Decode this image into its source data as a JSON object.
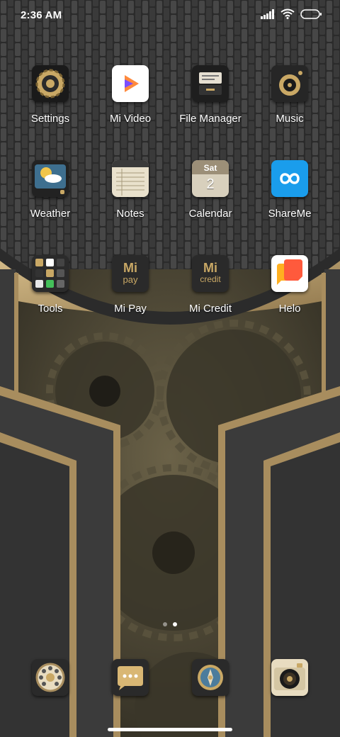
{
  "status_bar": {
    "time": "2:36 AM"
  },
  "apps": [
    {
      "label": "Settings",
      "icon": "settings-gear-icon"
    },
    {
      "label": "Mi Video",
      "icon": "play-icon"
    },
    {
      "label": "File Manager",
      "icon": "file-cabinet-icon"
    },
    {
      "label": "Music",
      "icon": "speaker-icon"
    },
    {
      "label": "Weather",
      "icon": "weather-tv-icon"
    },
    {
      "label": "Notes",
      "icon": "notepad-icon"
    },
    {
      "label": "Calendar",
      "icon": "calendar-icon",
      "weekday": "Sat",
      "day": "2"
    },
    {
      "label": "ShareMe",
      "icon": "infinity-share-icon"
    },
    {
      "label": "Tools",
      "icon": "folder-grid-icon"
    },
    {
      "label": "Mi Pay",
      "icon": "mi-pay-icon",
      "badge_top": "Mi",
      "badge_bottom": "pay"
    },
    {
      "label": "Mi Credit",
      "icon": "mi-credit-icon",
      "badge_top": "Mi",
      "badge_bottom": "credit"
    },
    {
      "label": "Helo",
      "icon": "chat-bubbles-icon"
    }
  ],
  "dock": [
    {
      "icon": "rotary-phone-icon"
    },
    {
      "icon": "message-bubble-icon"
    },
    {
      "icon": "browser-compass-icon"
    },
    {
      "icon": "camera-lens-icon"
    }
  ],
  "pager": {
    "pages": 2,
    "active": 2
  },
  "colors": {
    "gold": "#b89a66",
    "dark": "#2a2a2a",
    "text": "#ffffff"
  }
}
